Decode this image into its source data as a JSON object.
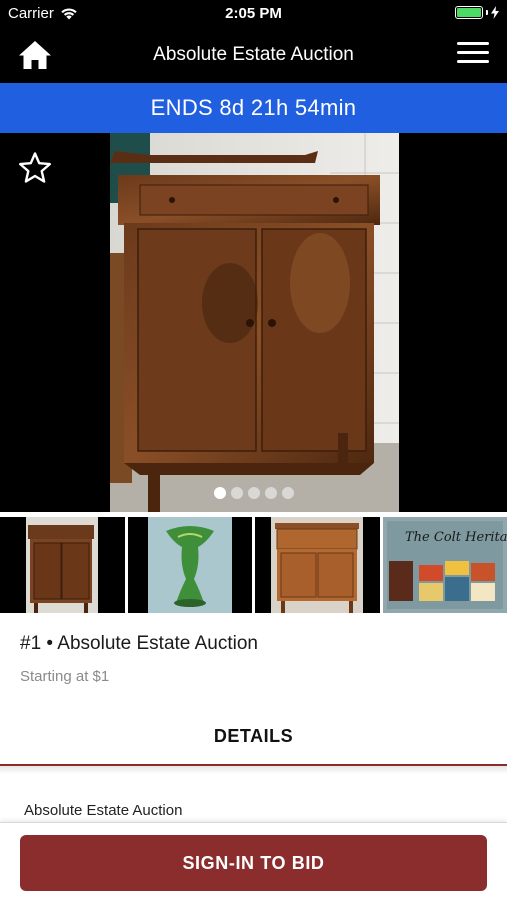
{
  "status_bar": {
    "carrier": "Carrier",
    "time": "2:05 PM"
  },
  "nav": {
    "title": "Absolute Estate Auction",
    "home_icon": "home-icon",
    "menu_icon": "hamburger-menu-icon"
  },
  "ends_banner": {
    "text": "ENDS 8d 21h 54min",
    "color": "#1f5fe0"
  },
  "hero": {
    "favorite_icon": "star-outline-icon",
    "image_count": 5,
    "active_index": 0
  },
  "thumbnails": [
    {
      "alt": "wooden-cabinet-thumbnail"
    },
    {
      "alt": "green-vase-thumbnail"
    },
    {
      "alt": "wooden-sideboard-thumbnail"
    },
    {
      "alt": "book-cover-thumbnail"
    }
  ],
  "lot": {
    "title": "#1 • Absolute Estate Auction",
    "starting": "Starting at $1"
  },
  "tabs": {
    "details": "DETAILS"
  },
  "description": {
    "first_line": "Absolute Estate Auction"
  },
  "actions": {
    "bid_label": "SIGN-IN TO BID",
    "accent_color": "#8b2d2d"
  }
}
